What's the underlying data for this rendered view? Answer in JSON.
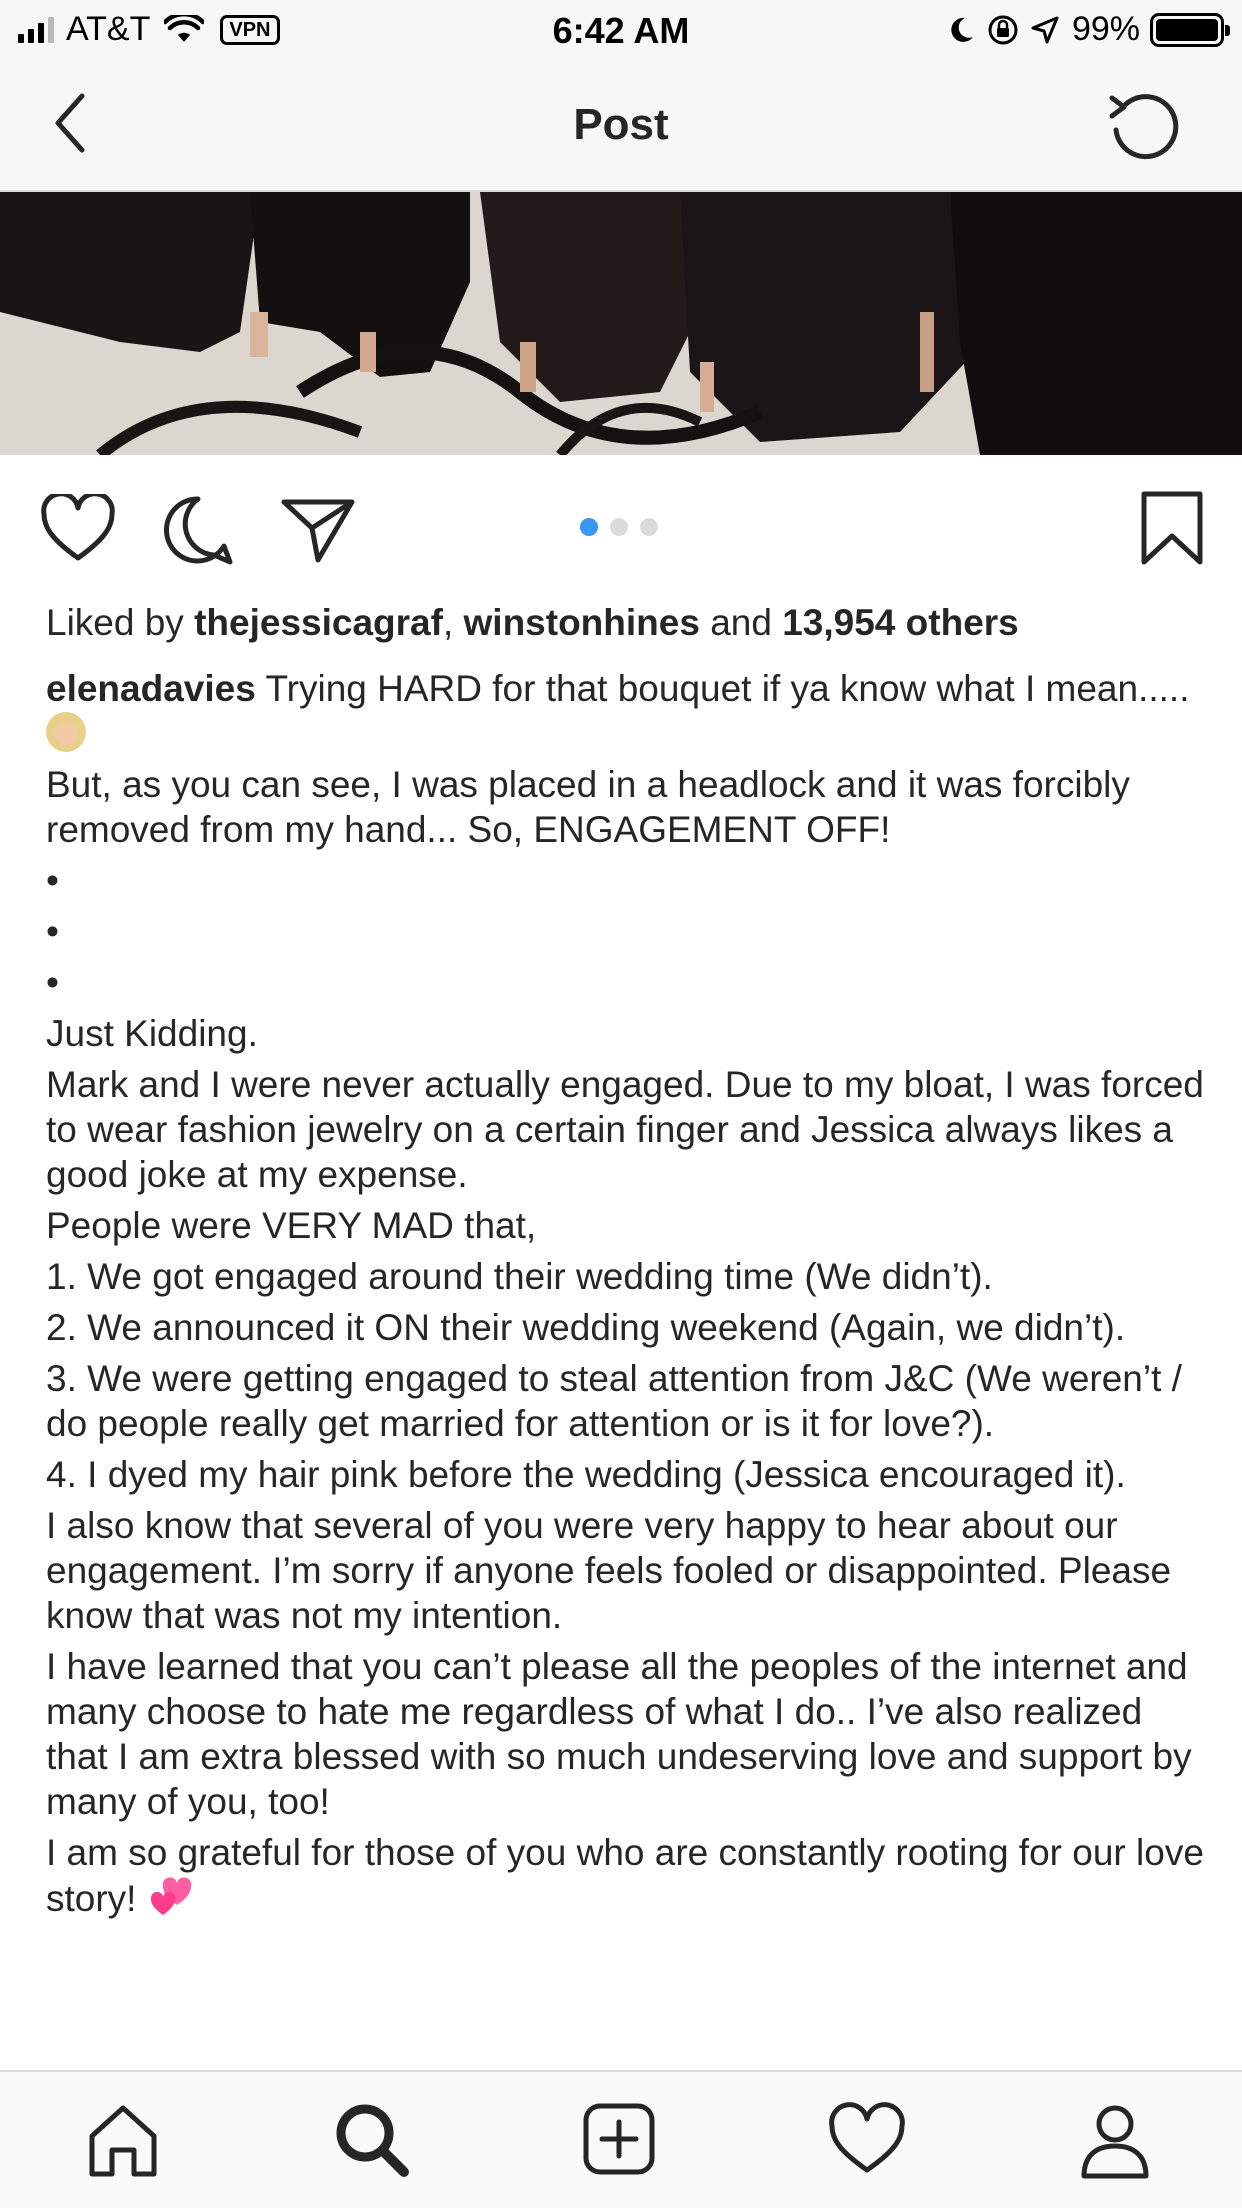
{
  "status_bar": {
    "carrier": "AT&T",
    "vpn": "VPN",
    "time": "6:42 AM",
    "battery": "99%"
  },
  "nav": {
    "title": "Post"
  },
  "post": {
    "carousel_index": 1,
    "carousel_count": 3,
    "likes": {
      "prefix": "Liked by",
      "user1": "thejessicagraf",
      "sep": ",",
      "user2": "winstonhines",
      "and": "and",
      "others": "13,954 others"
    },
    "caption": {
      "username": "elenadavies",
      "line1": "Trying HARD for that bouquet if ya know what I mean.....",
      "line2": "But, as you can see, I was placed in a headlock and it was forcibly removed from my hand... So, ENGAGEMENT OFF!",
      "bullet": "•",
      "line3": "Just Kidding.",
      "line4": "Mark and I were never actually engaged. Due to my bloat, I was forced to wear fashion jewelry on a certain finger and Jessica always likes a good joke at my expense.",
      "line5": "People were VERY MAD that,",
      "item1": "1. We got engaged around their wedding time (We didn’t).",
      "item2": "2. We announced it ON their wedding weekend (Again, we didn’t).",
      "item3": "3. We were getting engaged to steal attention from J&C (We weren’t / do people really get married for attention or is it for love?).",
      "item4": "4. I dyed my hair pink before the wedding (Jessica encouraged it).",
      "line6": "I also know that several of you were very happy to hear about our engagement. I’m sorry if anyone feels fooled or disappointed. Please know that was not my intention.",
      "line7": "I have learned that you can’t please all the peoples of the internet and many choose to hate me regardless of what I do.. I’ve also realized that I am extra blessed with so much undeserving love and support by many of you, too!",
      "line8": "I am so grateful for those of you who are constantly rooting for our love story!"
    }
  },
  "icons": {
    "back": "chevron-left-icon",
    "refresh": "refresh-icon",
    "like": "heart-icon",
    "comment": "comment-icon",
    "share": "paper-plane-icon",
    "save": "bookmark-icon",
    "tab_home": "home-icon",
    "tab_search": "search-icon",
    "tab_add": "add-post-icon",
    "tab_activity": "heart-icon",
    "tab_profile": "profile-icon"
  },
  "colors": {
    "accent": "#3897f0",
    "text": "#262626",
    "divider": "#dbdbdb"
  }
}
